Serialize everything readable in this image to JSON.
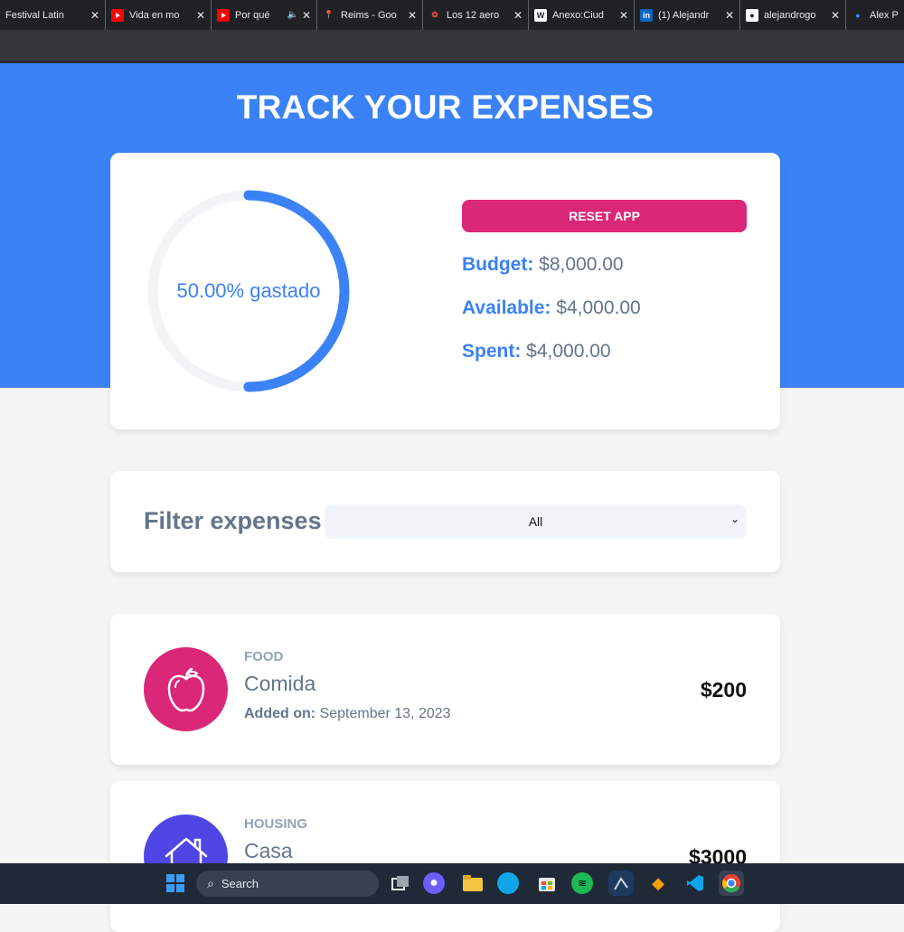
{
  "browser": {
    "tabs": [
      {
        "title": "Festival Latin",
        "icon": "generic-icon"
      },
      {
        "title": "Vida en mo",
        "icon": "youtube-icon"
      },
      {
        "title": "Por qué",
        "icon": "youtube-icon",
        "audio": true
      },
      {
        "title": "Reims - Goo",
        "icon": "maps-icon"
      },
      {
        "title": "Los 12 aero",
        "icon": "rose-icon"
      },
      {
        "title": "Anexo:Ciud",
        "icon": "wikipedia-icon"
      },
      {
        "title": "(1) Alejandr",
        "icon": "linkedin-icon"
      },
      {
        "title": "alejandrogo",
        "icon": "github-icon"
      },
      {
        "title": "Alex Portfol",
        "icon": "portfolio-icon"
      }
    ]
  },
  "app": {
    "title": "TRACK YOUR EXPENSES",
    "progress": {
      "percent": 50,
      "text": "50.00% gastado"
    },
    "reset_label": "RESET APP",
    "budget": {
      "label": "Budget:",
      "value": "$8,000.00"
    },
    "available": {
      "label": "Available:",
      "value": "$4,000.00"
    },
    "spent": {
      "label": "Spent:",
      "value": "$4,000.00"
    },
    "filter": {
      "label": "Filter expenses",
      "selected": "All"
    },
    "expenses": [
      {
        "category": "FOOD",
        "name": "Comida",
        "date_label": "Added on:",
        "date": "September 13, 2023",
        "amount": "$200",
        "icon": "apple-icon",
        "color": "#db2777"
      },
      {
        "category": "HOUSING",
        "name": "Casa",
        "date_label": "Added on:",
        "date": "",
        "amount": "$3000",
        "icon": "house-icon",
        "color": "#4f46e5"
      }
    ]
  },
  "colors": {
    "accent": "#3b82f6",
    "reset": "#db2777"
  },
  "taskbar": {
    "search_placeholder": "Search"
  }
}
